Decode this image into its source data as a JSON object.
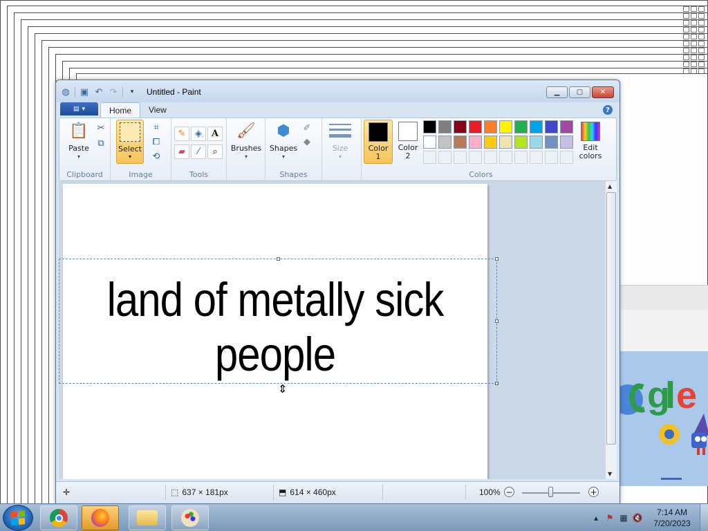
{
  "window": {
    "title": "Untitled - Paint"
  },
  "tabs": {
    "home": "Home",
    "view": "View"
  },
  "ribbon": {
    "clipboard": {
      "label": "Clipboard",
      "paste": "Paste"
    },
    "image": {
      "label": "Image",
      "select": "Select"
    },
    "tools": {
      "label": "Tools"
    },
    "brushes": "Brushes",
    "shapes": {
      "label": "Shapes",
      "shapes": "Shapes"
    },
    "size": "Size",
    "colors": {
      "label": "Colors",
      "color1_line1": "Color",
      "color1_line2": "1",
      "color2_line1": "Color",
      "color2_line2": "2",
      "edit_line1": "Edit",
      "edit_line2": "colors",
      "color1": "#000000",
      "color2": "#ffffff",
      "palette": [
        "#000000",
        "#7f7f7f",
        "#880015",
        "#ed1c24",
        "#ff7f27",
        "#fff200",
        "#22b14c",
        "#00a2e8",
        "#3f48cc",
        "#a349a4",
        "#ffffff",
        "#c3c3c3",
        "#b97a57",
        "#ffaec9",
        "#ffc90e",
        "#efe4b0",
        "#b5e61d",
        "#99d9ea",
        "#7092be",
        "#c8bfe7"
      ]
    }
  },
  "canvas": {
    "text": "land of metally sick people"
  },
  "status": {
    "selection_size": "637 × 181px",
    "canvas_size": "614 × 460px",
    "zoom": "100%"
  },
  "taskbar": {
    "time": "7:14 AM",
    "date": "7/20/2023"
  }
}
